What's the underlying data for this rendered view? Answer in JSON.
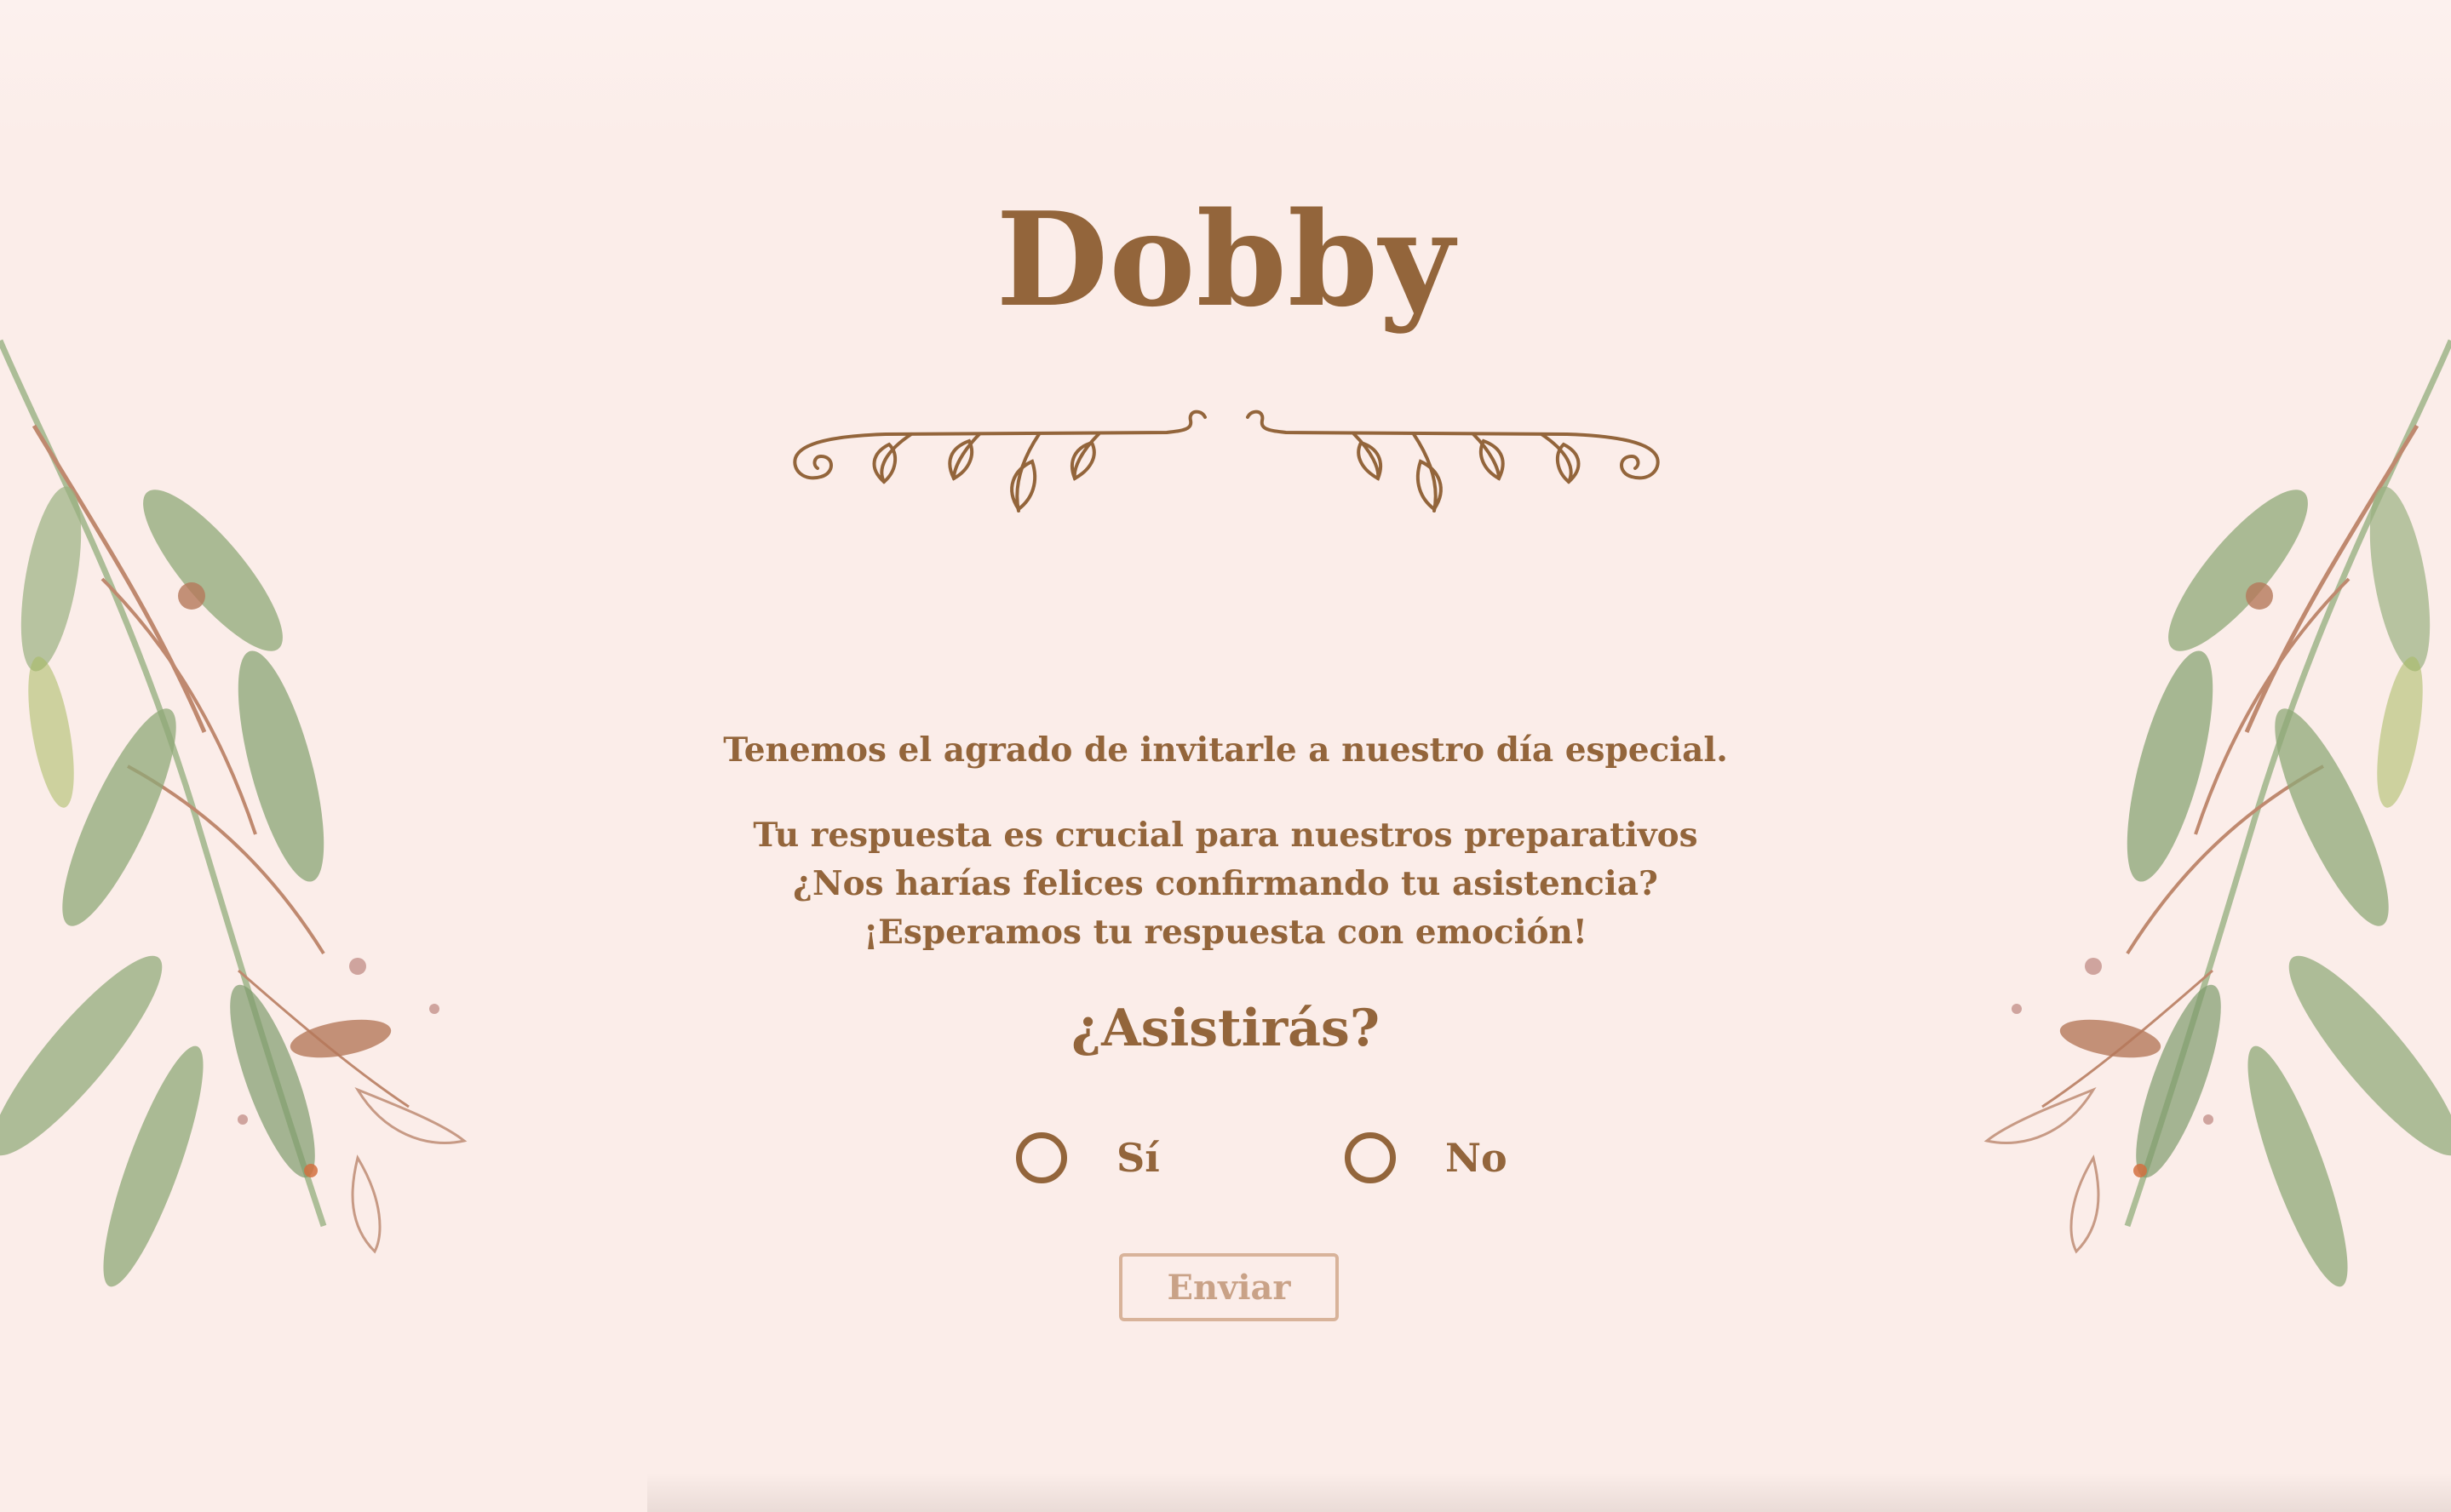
{
  "title": "Dobby",
  "intro": "Tenemos el agrado de invitarle a nuestro día especial.",
  "message": {
    "line1": "Tu respuesta es crucial para nuestros preparativos",
    "line2": "¿Nos harías felices confirmando tu asistencia?",
    "line3": "¡Esperamos tu respuesta con emoción!"
  },
  "rsvp": {
    "question": "¿Asistirás?",
    "options": [
      {
        "label": "Sí",
        "selected": false
      },
      {
        "label": "No",
        "selected": false
      }
    ],
    "submit_label": "Enviar"
  },
  "colors": {
    "background": "#fbede9",
    "text": "#93653b",
    "button_border": "#d8b39a",
    "button_text": "#c9a287",
    "leaf_green": "#8fa877",
    "copper": "#b5785a"
  },
  "decorations": {
    "ornament": "flourish-divider-icon",
    "foliage": "watercolor-eucalyptus-branch-icon"
  }
}
